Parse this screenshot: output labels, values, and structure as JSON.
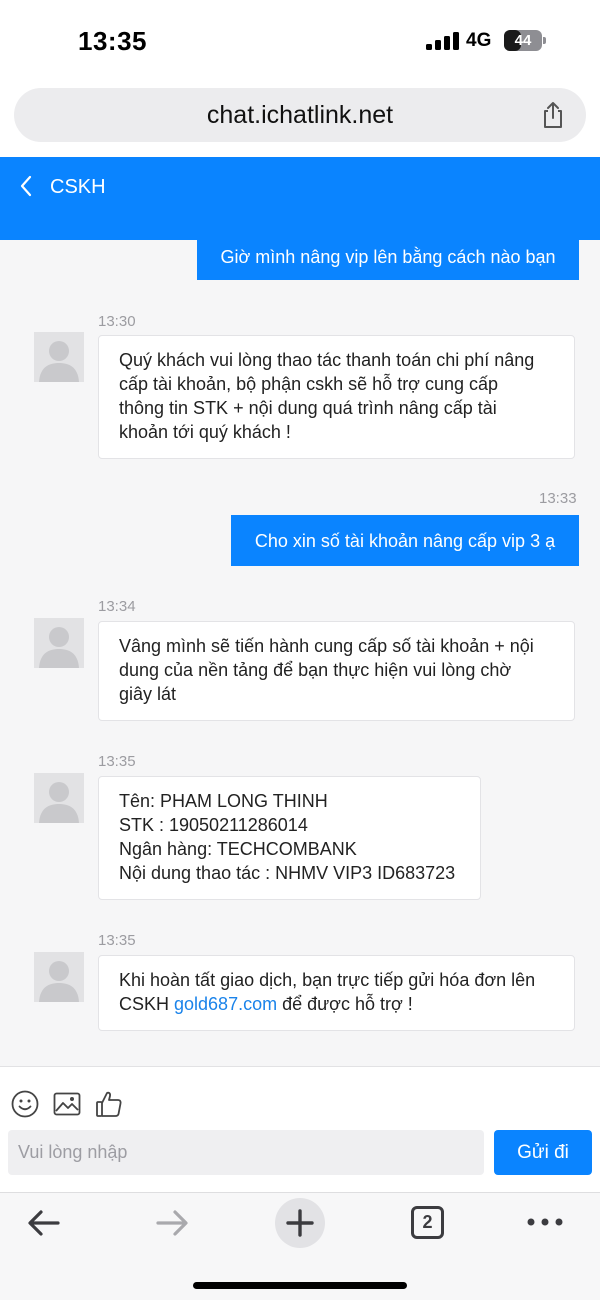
{
  "status_bar": {
    "time": "13:35",
    "network": "4G",
    "battery": "44",
    "battery_fraction": 0.44
  },
  "browser": {
    "url": "chat.ichatlink.net",
    "tabs_count": "2"
  },
  "header": {
    "back_icon": "chevron-left-icon",
    "title": "CSKH"
  },
  "messages": [
    {
      "direction": "out",
      "text": "Giờ mình nâng vip lên bằng cách nào bạn"
    },
    {
      "direction": "in",
      "time": "13:30",
      "lines": [
        "Quý khách vui lòng thao tác thanh toán chi phí nâng",
        "cấp tài khoản, bộ phận cskh sẽ hỗ trợ cung cấp",
        "thông tin STK + nội dung quá trình nâng cấp tài",
        "khoản tới quý khách !"
      ]
    },
    {
      "direction": "out",
      "time": "13:33",
      "text": "Cho xin số tài khoản nâng cấp vip 3 ạ"
    },
    {
      "direction": "in",
      "time": "13:34",
      "lines": [
        "Vâng mình sẽ tiến hành cung cấp số tài khoản + nội",
        "dung của nền tảng để bạn thực hiện vui lòng chờ",
        "giây lát"
      ]
    },
    {
      "direction": "in",
      "time": "13:35",
      "lines": [
        "Tên: PHAM LONG THINH",
        "STK : 19050211286014",
        "Ngân hàng: TECHCOMBANK",
        "Nội dung thao tác : NHMV VIP3 ID683723"
      ]
    },
    {
      "direction": "in",
      "time": "13:35",
      "lines": [
        "Khi hoàn tất giao dịch, bạn trực tiếp gửi hóa đơn lên"
      ],
      "line2_prefix": "CSKH ",
      "link": "gold687.com",
      "line2_suffix": " để được hỗ trợ !"
    }
  ],
  "composer": {
    "placeholder": "Vui lòng nhập",
    "send_label": "Gửi đi",
    "tools": [
      "smiley-icon",
      "image-icon",
      "thumbs-up-icon"
    ]
  },
  "colors": {
    "accent": "#0a84ff",
    "chat_background": "#f6f6f7",
    "link": "#1a83ea",
    "timestamp": "#9c9ca1"
  }
}
